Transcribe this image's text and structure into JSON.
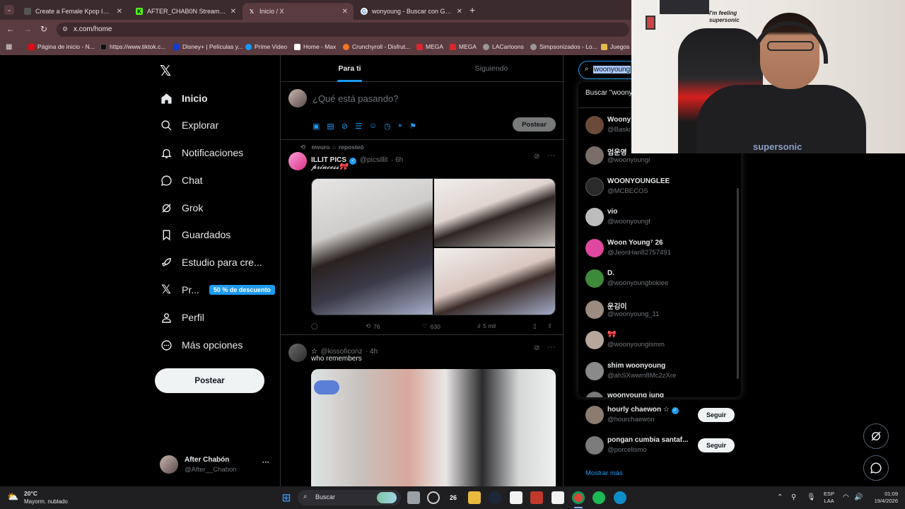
{
  "browser": {
    "tabs": [
      {
        "label": "Create a Female Kpop Idol Gi",
        "active": false,
        "favicon_color": "#444"
      },
      {
        "label": "AFTER_CHAB0N Stream - Watc",
        "active": false,
        "favicon_color": "#53fc18"
      },
      {
        "label": "Inicio / X",
        "active": true,
        "favicon_color": "#000"
      },
      {
        "label": "wonyoung - Buscar con Google",
        "active": false,
        "favicon_color": "#4285f4"
      }
    ],
    "url": "x.com/home",
    "bookmarks": [
      {
        "label": "Página de inicio - N...",
        "color": "#e50914"
      },
      {
        "label": "https://www.tiktok.c...",
        "color": "#111"
      },
      {
        "label": "Disney+ | Películas y...",
        "color": "#113ccf"
      },
      {
        "label": "Prime Video",
        "color": "#1a98ff"
      },
      {
        "label": "Home - Max",
        "color": "#002be7"
      },
      {
        "label": "Crunchyroll - Disfrut...",
        "color": "#f47521"
      },
      {
        "label": "MEGA",
        "color": "#d9272e"
      },
      {
        "label": "MEGA",
        "color": "#d9272e"
      },
      {
        "label": "LACartoons",
        "color": "#888"
      },
      {
        "label": "Simpsonizados - Lo...",
        "color": "#888"
      },
      {
        "label": "Juegos",
        "color": "#888"
      }
    ]
  },
  "sidebar": {
    "items": [
      {
        "label": "Inicio",
        "icon": "home-icon",
        "active": true
      },
      {
        "label": "Explorar",
        "icon": "search-icon"
      },
      {
        "label": "Notificaciones",
        "icon": "bell-icon"
      },
      {
        "label": "Chat",
        "icon": "chat-icon"
      },
      {
        "label": "Grok",
        "icon": "grok-icon"
      },
      {
        "label": "Guardados",
        "icon": "bookmark-icon"
      },
      {
        "label": "Estudio para cre...",
        "icon": "rocket-icon"
      },
      {
        "label": "Pr...",
        "icon": "x-premium-icon"
      },
      {
        "label": "Perfil",
        "icon": "person-icon"
      },
      {
        "label": "Más opciones",
        "icon": "more-circle-icon"
      }
    ],
    "premium_badge": "50 % de descuento",
    "post_button": "Postear",
    "account": {
      "name": "After Chabón",
      "handle": "@After__Chabon",
      "more": "···"
    }
  },
  "feed": {
    "tabs": [
      {
        "label": "Para ti",
        "active": true
      },
      {
        "label": "Siguiendo",
        "active": false
      }
    ],
    "composer": {
      "placeholder": "¿Qué está pasando?",
      "button": "Postear"
    },
    "tweets": [
      {
        "reposted_by": "mvuro ☆ reposteó",
        "name": "ILLIT PICS",
        "verified": true,
        "handle": "@picsillit",
        "time": "· 6h",
        "text": "𝓹𝓻𝓲𝓷𝓬𝓮𝓼𝓼🎀",
        "stats": {
          "reply": "",
          "retweet": "76",
          "like": "630",
          "views": "5 mil"
        }
      },
      {
        "name": "☆",
        "handle": "@kissoficonz",
        "time": "· 4h",
        "text": "who remembers"
      }
    ]
  },
  "search": {
    "query": "woonyoung",
    "suggestion": "Buscar \"woony",
    "results": [
      {
        "name": "Woony",
        "handle": "@Baski",
        "color": "#6b4a3a"
      },
      {
        "name": "엄운영",
        "handle": "@woonyoungi",
        "color": "#7a6e68"
      },
      {
        "name": "WOONYOUNGLEE",
        "handle": "@MCBECOS",
        "color": "#2a2a2a"
      },
      {
        "name": "vio",
        "handle": "@woonyoungf",
        "color": "#bdbdbd"
      },
      {
        "name": "Woon Young⁷ 26",
        "handle": "@JeonHan82757491",
        "color": "#e0479e"
      },
      {
        "name": "D.",
        "handle": "@woonyoungbokiee",
        "color": "#3d8a3a"
      },
      {
        "name": "운깅이",
        "handle": "@woonyoung_11",
        "color": "#9c8b80"
      },
      {
        "name": "🎀",
        "handle": "@woonyoungismm",
        "color": "#b7a69c"
      },
      {
        "name": "shim woonyoung",
        "handle": "@ahSXwwm8Mc2zXre",
        "color": "#8a8a8a"
      },
      {
        "name": "woonyoung jung",
        "handle": "",
        "color": "#777"
      }
    ]
  },
  "who_to_follow": {
    "items": [
      {
        "name": "hourly chaewon ☆",
        "verified": true,
        "handle": "@hourchaewon",
        "button": "Seguir"
      },
      {
        "name": "pongan cumbia santaf...",
        "verified": false,
        "handle": "@porcelismo",
        "button": "Seguir"
      }
    ],
    "show_more": "Mostrar más"
  },
  "webcam": {
    "sign_text": "I'm feeling supersonic",
    "shirt_text": "supersonic"
  },
  "taskbar": {
    "weather_temp": "20°C",
    "weather_desc": "Mayorm. nublado",
    "search": "Buscar",
    "badge": "26",
    "lang": "ESP",
    "lang2": "LAA",
    "time": "01:09",
    "date": "19/4/2026"
  },
  "colors": {
    "accent": "#1d9bf0",
    "bg": "#000000",
    "border": "#2f3336",
    "muted": "#71767b"
  }
}
